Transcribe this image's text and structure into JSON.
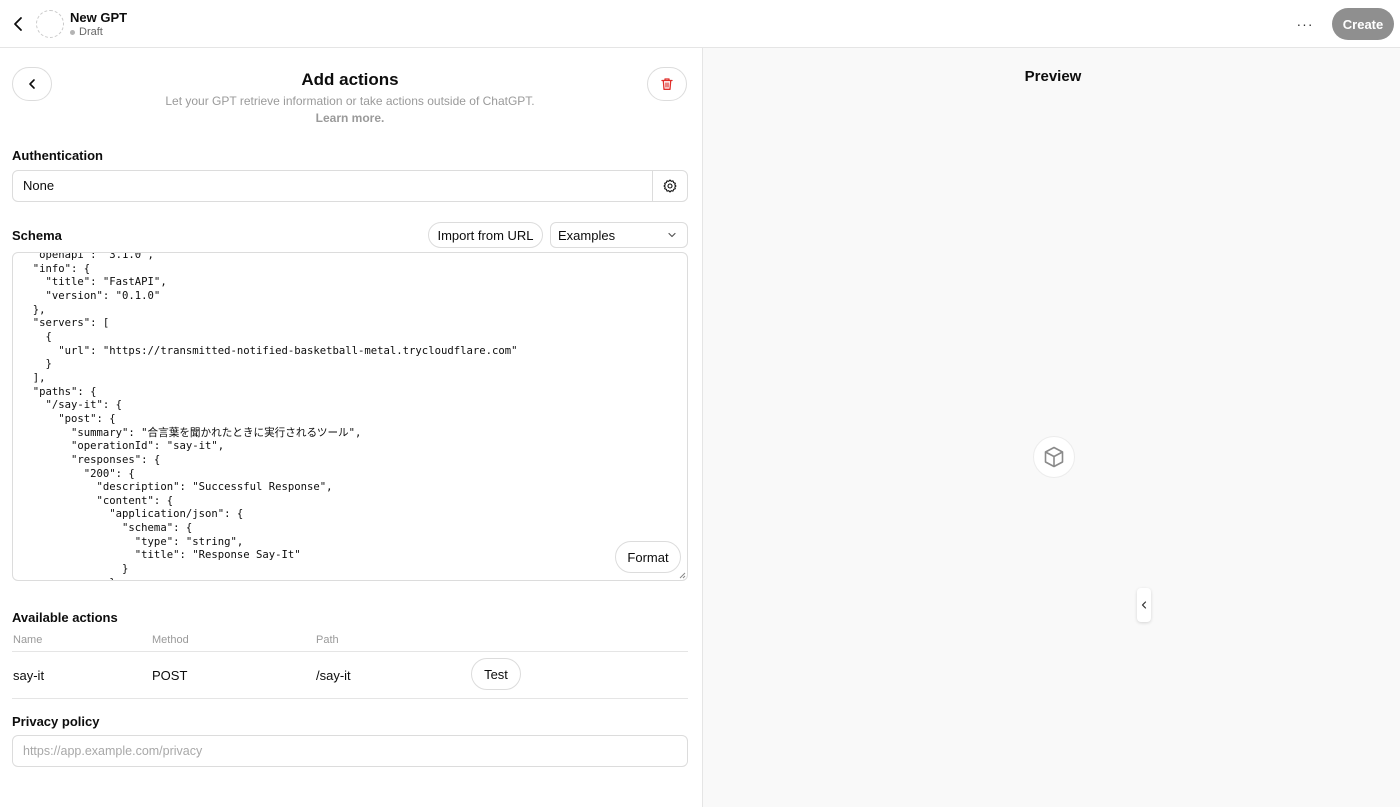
{
  "topbar": {
    "gpt_name": "New GPT",
    "gpt_status": "Draft",
    "more_label": "···",
    "create_label": "Create"
  },
  "header": {
    "title": "Add actions",
    "subtitle": "Let your GPT retrieve information or take actions outside of ChatGPT.",
    "learn_more": "Learn more."
  },
  "authentication": {
    "label": "Authentication",
    "value": "None"
  },
  "schema": {
    "label": "Schema",
    "import_label": "Import from URL",
    "examples_label": "Examples",
    "format_label": "Format",
    "code": "  \"openapi\": \"3.1.0\",\n  \"info\": {\n    \"title\": \"FastAPI\",\n    \"version\": \"0.1.0\"\n  },\n  \"servers\": [\n    {\n      \"url\": \"https://transmitted-notified-basketball-metal.trycloudflare.com\"\n    }\n  ],\n  \"paths\": {\n    \"/say-it\": {\n      \"post\": {\n        \"summary\": \"合言葉を聞かれたときに実行されるツール\",\n        \"operationId\": \"say-it\",\n        \"responses\": {\n          \"200\": {\n            \"description\": \"Successful Response\",\n            \"content\": {\n              \"application/json\": {\n                \"schema\": {\n                  \"type\": \"string\",\n                  \"title\": \"Response Say-It\"\n                }\n              }"
  },
  "actions": {
    "label": "Available actions",
    "columns": {
      "name": "Name",
      "method": "Method",
      "path": "Path"
    },
    "rows": [
      {
        "name": "say-it",
        "method": "POST",
        "path": "/say-it",
        "test_label": "Test"
      }
    ]
  },
  "privacy": {
    "label": "Privacy policy",
    "placeholder": "https://app.example.com/privacy",
    "value": ""
  },
  "preview": {
    "title": "Preview",
    "icon": "cube-icon"
  },
  "colors": {
    "create_button": "#8f8f8f",
    "delete_icon": "#e02e2a",
    "border": "#dcdcdc",
    "preview_bg": "#f9f9f9"
  }
}
